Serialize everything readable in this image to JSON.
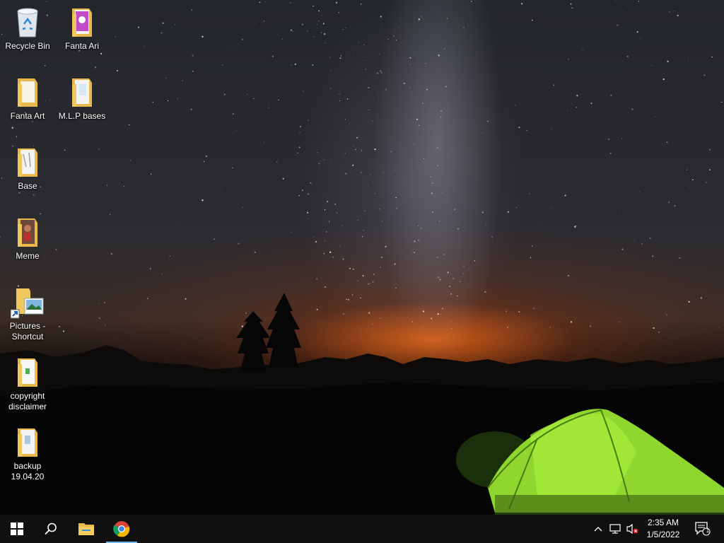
{
  "desktop": {
    "icons": [
      {
        "label": "Recycle Bin",
        "icon": "recycle-bin-icon"
      },
      {
        "label": "Fanta Ari",
        "icon": "folder-icon"
      },
      {
        "label": "Fanta Art",
        "icon": "folder-icon"
      },
      {
        "label": "M.L.P bases",
        "icon": "folder-icon"
      },
      {
        "label": "Base",
        "icon": "folder-icon"
      },
      {
        "label": "Meme",
        "icon": "folder-icon"
      },
      {
        "label": "Pictures - Shortcut",
        "icon": "shortcut-folder-icon"
      },
      {
        "label": "copyright disclaimer",
        "icon": "folder-icon"
      },
      {
        "label": "backup 19.04.20",
        "icon": "folder-icon"
      }
    ]
  },
  "taskbar": {
    "pinned": [
      {
        "name": "start-button",
        "icon": "windows-logo-icon"
      },
      {
        "name": "search-button",
        "icon": "search-icon"
      },
      {
        "name": "file-explorer-button",
        "icon": "folder-icon"
      },
      {
        "name": "chrome-button",
        "icon": "chrome-icon",
        "active": true
      }
    ],
    "tray": {
      "time": "2:35 AM",
      "date": "1/5/2022",
      "notification_count": "1",
      "icons": [
        "chevron-up-icon",
        "network-icon",
        "volume-muted-icon"
      ]
    }
  },
  "colors": {
    "taskbar": "#101010",
    "active_indicator": "#76b9ed",
    "folder": "#f0c75e",
    "tent": "#8fd62e"
  }
}
